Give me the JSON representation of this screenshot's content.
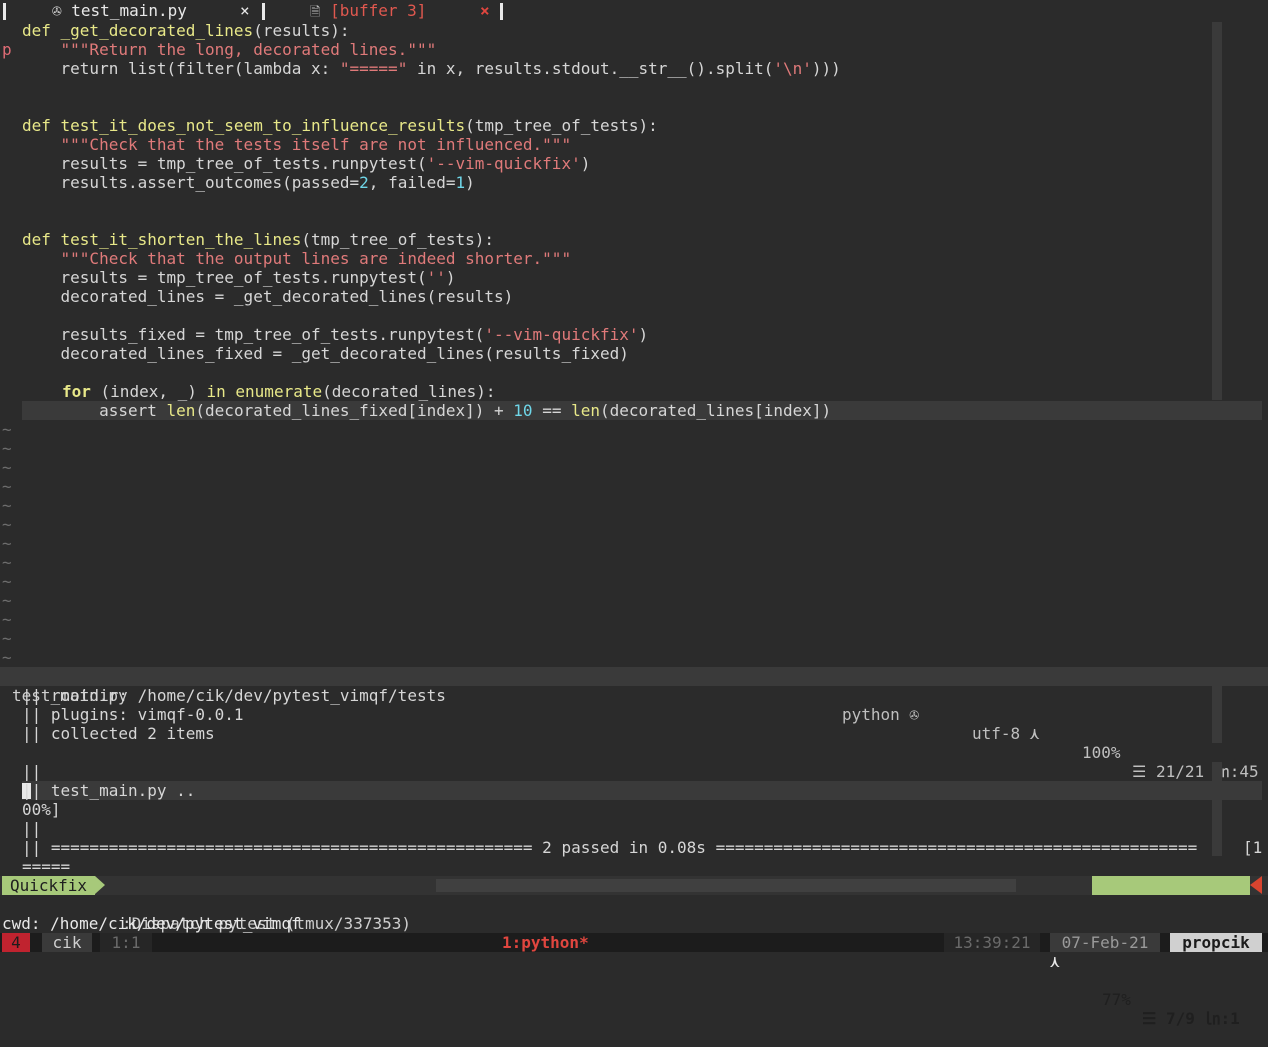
{
  "tabs": {
    "tab1": {
      "icon": "✇",
      "label": "test_main.py",
      "close": "×"
    },
    "tab2": {
      "icon": "🗎",
      "label": "[buffer 3]",
      "close": "×"
    }
  },
  "editor": {
    "gutter_marker": "p",
    "code": {
      "l1_def": "def ",
      "l1_fn": "_get_decorated_lines",
      "l1_rest": "(results):",
      "l2_doc": "    \"\"\"Return the long, decorated lines.\"\"\"",
      "l3_a": "    return list(filter(lambda x: ",
      "l3_s1": "\"=====\"",
      "l3_b": " in x, results.stdout.__str__().split(",
      "l3_s2": "'\\n'",
      "l3_c": ")))",
      "l6_def": "def ",
      "l6_fn": "test_it_does_not_seem_to_influence_results",
      "l6_rest": "(tmp_tree_of_tests):",
      "l7_doc": "    \"\"\"Check that the tests itself are not influenced.\"\"\"",
      "l8_a": "    results = tmp_tree_of_tests.runpytest(",
      "l8_s": "'--vim-quickfix'",
      "l8_c": ")",
      "l9_a": "    results.assert_outcomes(passed=",
      "l9_n1": "2",
      "l9_b": ", failed=",
      "l9_n2": "1",
      "l9_c": ")",
      "l12_def": "def ",
      "l12_fn": "test_it_shorten_the_lines",
      "l12_rest": "(tmp_tree_of_tests):",
      "l13_doc": "    \"\"\"Check that the output lines are indeed shorter.\"\"\"",
      "l14_a": "    results = tmp_tree_of_tests.runpytest(",
      "l14_s": "''",
      "l14_c": ")",
      "l15": "    decorated_lines = _get_decorated_lines(results)",
      "l17_a": "    results_fixed = tmp_tree_of_tests.runpytest(",
      "l17_s": "'--vim-quickfix'",
      "l17_c": ")",
      "l18": "    decorated_lines_fixed = _get_decorated_lines(results_fixed)",
      "l20_kw": "for",
      "l20_a": " (index, _) ",
      "l20_kw2": "in",
      "l20_sp": " ",
      "l20_fn": "enumerate",
      "l20_b": "(decorated_lines):",
      "l21_a": "        assert ",
      "l21_fn1": "len",
      "l21_b": "(decorated_lines_fixed[index]) + ",
      "l21_n": "10",
      "l21_c": " == ",
      "l21_fn2": "len",
      "l21_d": "(decorated_lines[index])"
    },
    "tilde": "~"
  },
  "statusline": {
    "filename": "test_main.py",
    "filetype": "python ✇",
    "encoding": "utf-8 ⋏",
    "percent": "100%",
    "position": "☰ 21/21 ㏑:45"
  },
  "quickfix": {
    "lines": [
      "|| rootdir: /home/cik/dev/pytest_vimqf/tests",
      "|| plugins: vimqf-0.0.1",
      "|| collected 2 items",
      "",
      "||",
      "|| test_main.py ..",
      "00%]",
      "||",
      "|| ================================================== 2 passed in 0.08s ==================================================",
      "====="
    ],
    "right_wrap": "[1",
    "mode": "Quickfix",
    "title": ":Dispatch pytest (tmux/337353)",
    "right_icon": "⋏",
    "percent": "77%",
    "position": "☰ 7/9 ㏑:1"
  },
  "cmdline": "cwd: /home/cik/dev/pytest_vimqf",
  "tmux": {
    "session": "4",
    "user": "cik",
    "pane": "1:1",
    "window": "1:python*",
    "time": "13:39:21",
    "date": "07-Feb-21",
    "host": "propcik"
  },
  "colors": {
    "background": "#2b2b2b",
    "keyword": "#e8e889",
    "string": "#e07a7a",
    "number": "#6fd6e8",
    "mode_green": "#a7c97a",
    "tmux_red": "#c0232f"
  }
}
